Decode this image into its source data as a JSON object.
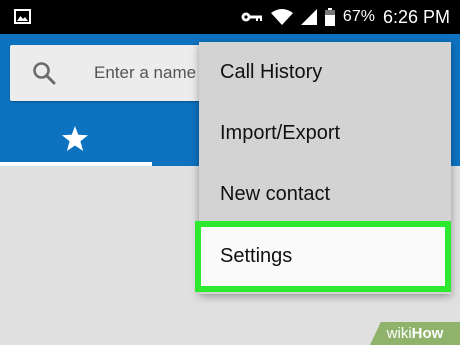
{
  "status_bar": {
    "battery_percent": "67%",
    "time": "6:26 PM",
    "icons": [
      "image-icon",
      "key-icon",
      "wifi-icon",
      "signal-icon",
      "battery-icon"
    ]
  },
  "search": {
    "placeholder": "Enter a name"
  },
  "tabs": [
    {
      "icon": "star-icon"
    }
  ],
  "menu": {
    "items": [
      {
        "label": "Call History"
      },
      {
        "label": "Import/Export"
      },
      {
        "label": "New contact"
      },
      {
        "label": "Settings",
        "highlighted": true
      }
    ]
  },
  "watermark": {
    "prefix": "wiki",
    "suffix": "How"
  },
  "colors": {
    "app_bar": "#0d73c1",
    "highlight_outline": "#2eea2e",
    "menu_background": "#d3d3d3"
  }
}
